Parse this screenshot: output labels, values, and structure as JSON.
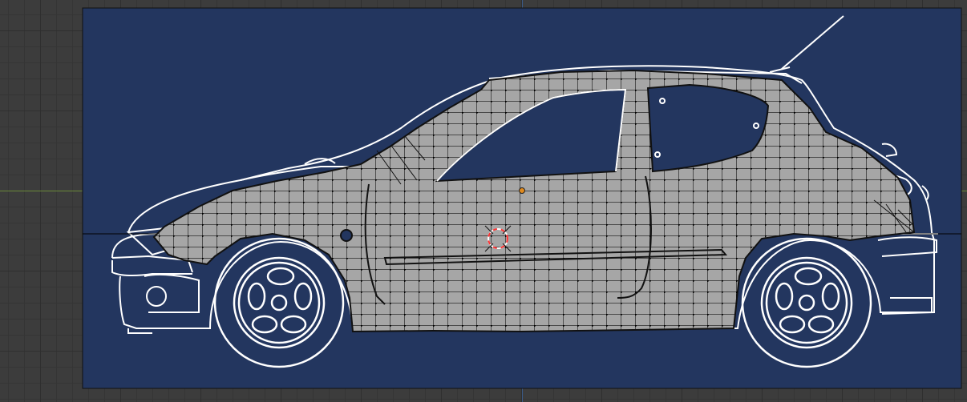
{
  "viewport": {
    "background": "#3c3c3c",
    "grid_color": "#2f2f2f",
    "x_axis_color": "#6a8a3a",
    "y_axis_color": "#3b5a86"
  },
  "reference_image": {
    "subject": "car-side-blueprint",
    "background": "#23365f",
    "line_color": "#ffffff"
  },
  "mesh": {
    "face_color": "#a6a6a6",
    "edge_color": "#111111",
    "vertex_color": "#000000",
    "mode": "edit-mode"
  },
  "origin_point": {
    "color": "#e08a1e"
  },
  "cursor_3d": {
    "ring_colors": [
      "#ff3333",
      "#ffffff"
    ],
    "icon": "3d-cursor-icon"
  }
}
